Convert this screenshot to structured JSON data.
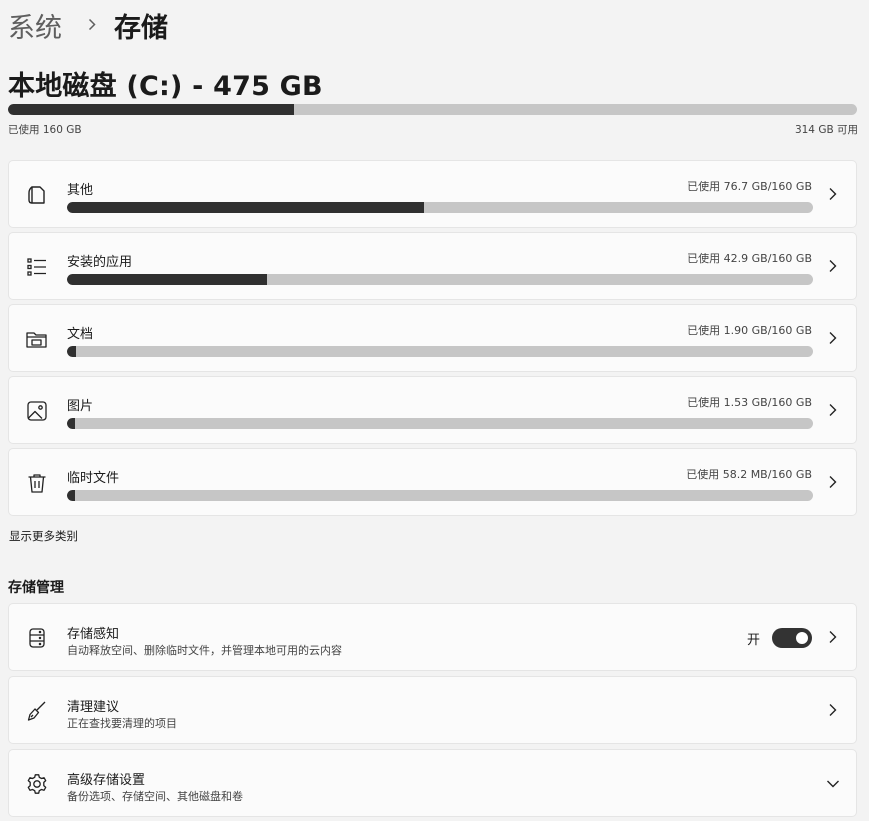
{
  "breadcrumb": {
    "parent": "系统",
    "current": "存储"
  },
  "disk": {
    "title": "本地磁盘 (C:) - 475 GB",
    "used_label": "已使用 160 GB",
    "free_label": "314 GB 可用",
    "used_fraction": 0.337
  },
  "categories": [
    {
      "label": "其他",
      "usage": "已使用 76.7 GB/160 GB",
      "icon": "file-icon",
      "fraction": 0.479
    },
    {
      "label": "安装的应用",
      "usage": "已使用 42.9 GB/160 GB",
      "icon": "list-icon",
      "fraction": 0.268
    },
    {
      "label": "文档",
      "usage": "已使用 1.90 GB/160 GB",
      "icon": "folder-icon",
      "fraction": 0.012
    },
    {
      "label": "图片",
      "usage": "已使用 1.53 GB/160 GB",
      "icon": "image-icon",
      "fraction": 0.0096
    },
    {
      "label": "临时文件",
      "usage": "已使用 58.2 MB/160 GB",
      "icon": "trash-icon",
      "fraction": 0.0004
    }
  ],
  "show_more": "显示更多类别",
  "management": {
    "title": "存储管理",
    "items": [
      {
        "title": "存储感知",
        "subtitle": "自动释放空间、删除临时文件，并管理本地可用的云内容",
        "icon": "storage-sense-icon",
        "toggle_label": "开",
        "toggle_on": true
      },
      {
        "title": "清理建议",
        "subtitle": "正在查找要清理的项目",
        "icon": "broom-icon"
      },
      {
        "title": "高级存储设置",
        "subtitle": "备份选项、存储空间、其他磁盘和卷",
        "icon": "gear-icon"
      }
    ]
  }
}
